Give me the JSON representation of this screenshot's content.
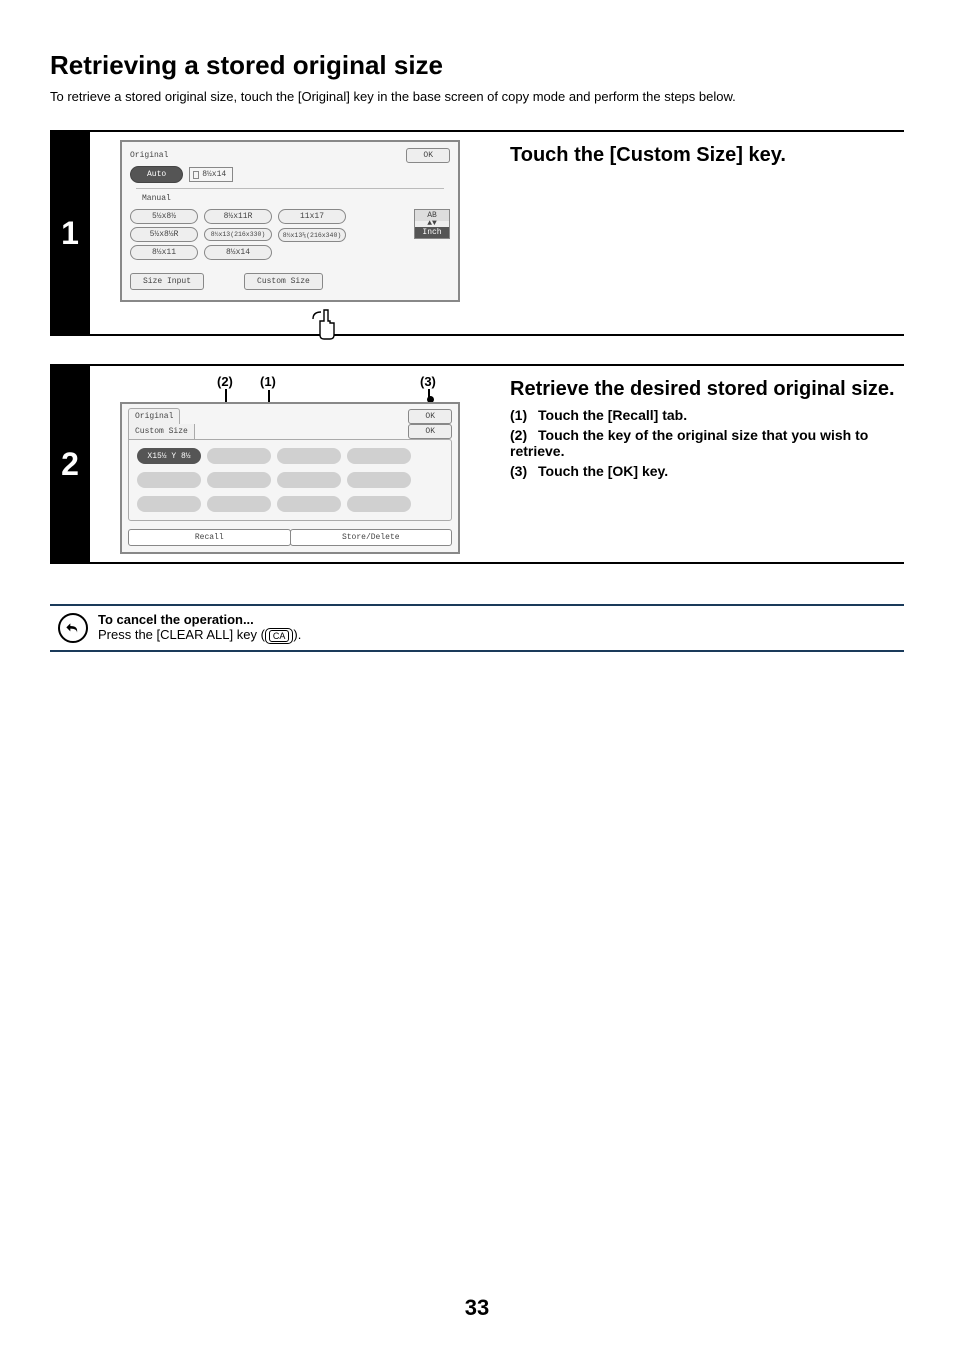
{
  "title": "Retrieving a stored original size",
  "intro": "To retrieve a stored original size, touch the [Original] key in the base screen of copy mode and perform the steps below.",
  "step1": {
    "num": "1",
    "heading": "Touch the [Custom Size] key.",
    "panel": {
      "title": "Original",
      "ok": "OK",
      "auto": "Auto",
      "paper": "8½x14",
      "manual": "Manual",
      "sizes_r1": [
        "5½x8½",
        "8½x11R",
        "11x17"
      ],
      "sizes_r2": [
        "5½x8½R",
        "8½x13(216x330)",
        "8½x13⅖(216x340)"
      ],
      "sizes_r3": [
        "8½x11",
        "8½x14"
      ],
      "unit_top": "AB",
      "unit_bot": "Inch",
      "size_input": "Size Input",
      "custom_size": "Custom Size"
    }
  },
  "step2": {
    "num": "2",
    "heading": "Retrieve the desired stored original size.",
    "item1_n": "(1)",
    "item1": "Touch the [Recall] tab.",
    "item2_n": "(2)",
    "item2": "Touch the key of the original size that you wish to retrieve.",
    "item3_n": "(3)",
    "item3": "Touch the [OK] key.",
    "callout1": "(1)",
    "callout2": "(2)",
    "callout3": "(3)",
    "panel": {
      "title": "Original",
      "ok_outer": "OK",
      "custom": "Custom Size",
      "ok_inner": "OK",
      "sel": "X15½ Y 8½",
      "recall": "Recall",
      "store": "Store/Delete"
    }
  },
  "note": {
    "t1": "To cancel the operation...",
    "t2a": "Press the [CLEAR ALL] key (",
    "ca": "CA",
    "t2b": ")."
  },
  "page_num": "33"
}
